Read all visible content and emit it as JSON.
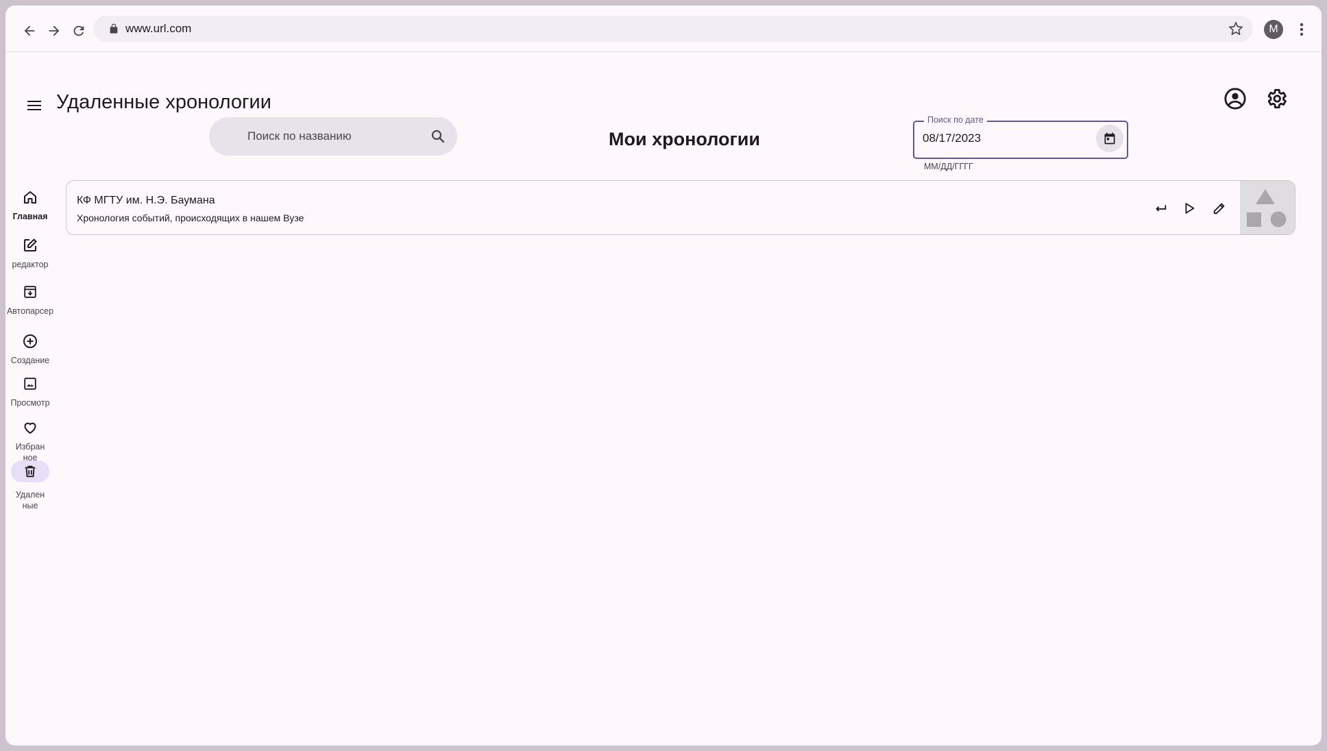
{
  "browser": {
    "url": "www.url.com",
    "profile_initial": "M"
  },
  "app": {
    "page_title": "Удаленные хронологии",
    "section_title": "Мои хронологии",
    "search": {
      "placeholder": "Поиск по названию"
    },
    "date_filter": {
      "label": "Поиск по дате",
      "value": "08/17/2023",
      "hint": "ММ/ДД/ГГГГ"
    }
  },
  "rail": {
    "items": [
      {
        "label": "Главная",
        "icon": "home-icon"
      },
      {
        "label": "редактор",
        "icon": "edit-icon"
      },
      {
        "label": "Автопарсер",
        "icon": "archive-download-icon"
      },
      {
        "label": "Создание",
        "icon": "add-circle-icon"
      },
      {
        "label": "Просмотр",
        "icon": "image-icon"
      },
      {
        "label": "Избран\nное",
        "icon": "heart-icon"
      },
      {
        "label": "Удален\nные",
        "icon": "trash-icon"
      }
    ],
    "active_index": 6
  },
  "timelines": [
    {
      "title": "КФ МГТУ им. Н.Э. Баумана",
      "description": "Хронология событий, происходящих в нашем Вузе"
    }
  ],
  "colors": {
    "primary": "#65558f",
    "background": "#fef7fc",
    "active_indicator": "#e8def8"
  }
}
